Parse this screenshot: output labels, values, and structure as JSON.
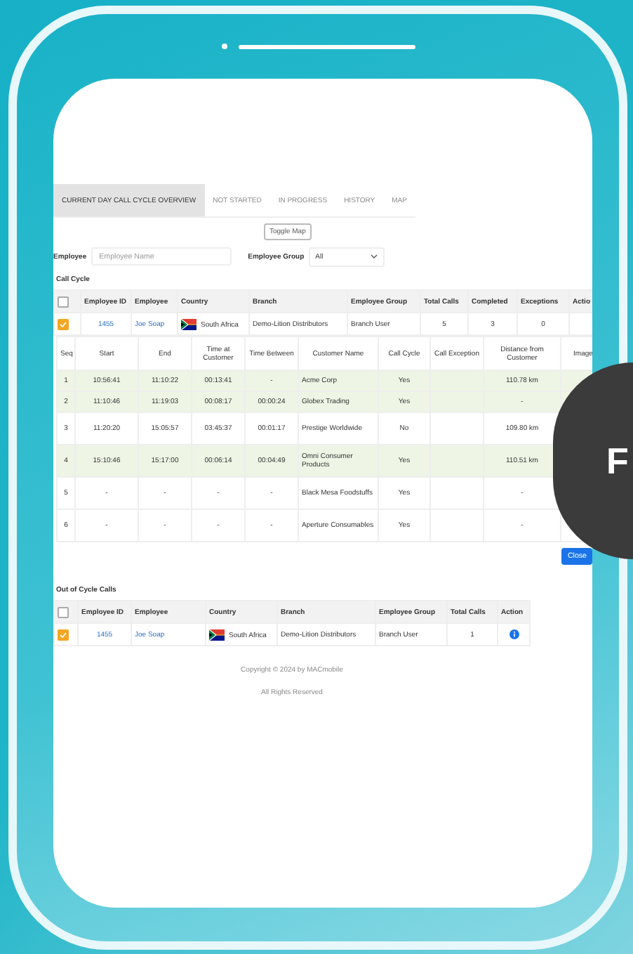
{
  "tabs": [
    {
      "label": "CURRENT DAY CALL CYCLE OVERVIEW",
      "selected": true
    },
    {
      "label": "NOT STARTED",
      "selected": false
    },
    {
      "label": "IN PROGRESS",
      "selected": false
    },
    {
      "label": "HISTORY",
      "selected": false
    },
    {
      "label": "MAP",
      "selected": false
    }
  ],
  "toggle_button": "Toggle Map",
  "filters": {
    "employee_label": "Employee",
    "employee_placeholder": "Employee Name",
    "group_label": "Employee Group",
    "group_value": "All"
  },
  "call_cycle": {
    "title": "Call Cycle",
    "columns": [
      "Employee ID",
      "Employee",
      "Country",
      "Branch",
      "Employee Group",
      "Total Calls",
      "Completed",
      "Exceptions",
      "Actio"
    ],
    "header_checked": false,
    "rows": [
      {
        "checked": true,
        "employee_id": "1455",
        "employee": "Joe Soap",
        "country": "South Africa",
        "branch": "Demo-Lition Distributors",
        "employee_group": "Branch User",
        "total_calls": "5",
        "completed": "3",
        "exceptions": "0"
      }
    ],
    "detail_columns": [
      "Seq",
      "Start",
      "End",
      "Time at Customer",
      "Time Between",
      "Customer Name",
      "Call Cycle",
      "Call Exception",
      "Distance from Customer",
      "Image"
    ],
    "detail_rows": [
      {
        "highlighted": true,
        "cells": [
          "1",
          "10:56:41",
          "11:10:22",
          "00:13:41",
          "-",
          "Acme Corp",
          "Yes",
          "",
          "110.78 km"
        ]
      },
      {
        "highlighted": true,
        "cells": [
          "2",
          "11:10:46",
          "11:19:03",
          "00:08:17",
          "00:00:24",
          "Globex Trading",
          "Yes",
          "",
          "-"
        ]
      },
      {
        "highlighted": false,
        "cells": [
          "3",
          "11:20:20",
          "15:05:57",
          "03:45:37",
          "00:01:17",
          "Prestige Worldwide",
          "No",
          "",
          "109.80 km"
        ]
      },
      {
        "highlighted": true,
        "cells": [
          "4",
          "15:10:46",
          "15:17:00",
          "00:06:14",
          "00:04:49",
          "Omni Consumer Products",
          "Yes",
          "",
          "110.51 km"
        ]
      },
      {
        "highlighted": false,
        "cells": [
          "5",
          "-",
          "-",
          "-",
          "-",
          "Black Mesa Foodstuffs",
          "Yes",
          "",
          "-"
        ]
      },
      {
        "highlighted": false,
        "cells": [
          "6",
          "-",
          "-",
          "-",
          "-",
          "Aperture Consumables",
          "Yes",
          "",
          "-"
        ]
      }
    ],
    "close_button": "Close"
  },
  "out_of_cycle": {
    "title": "Out of Cycle Calls",
    "columns": [
      "Employee ID",
      "Employee",
      "Country",
      "Branch",
      "Employee Group",
      "Total Calls",
      "Action"
    ],
    "header_checked": false,
    "rows": [
      {
        "checked": true,
        "employee_id": "1455",
        "employee": "Joe Soap",
        "country": "South Africa",
        "branch": "Demo-Lition Distributors",
        "employee_group": "Branch User",
        "total_calls": "1"
      }
    ]
  },
  "footer": [
    "Copyright © 2024 by MACmobile",
    "All Rights Reserved"
  ],
  "overlay_badge": "F"
}
